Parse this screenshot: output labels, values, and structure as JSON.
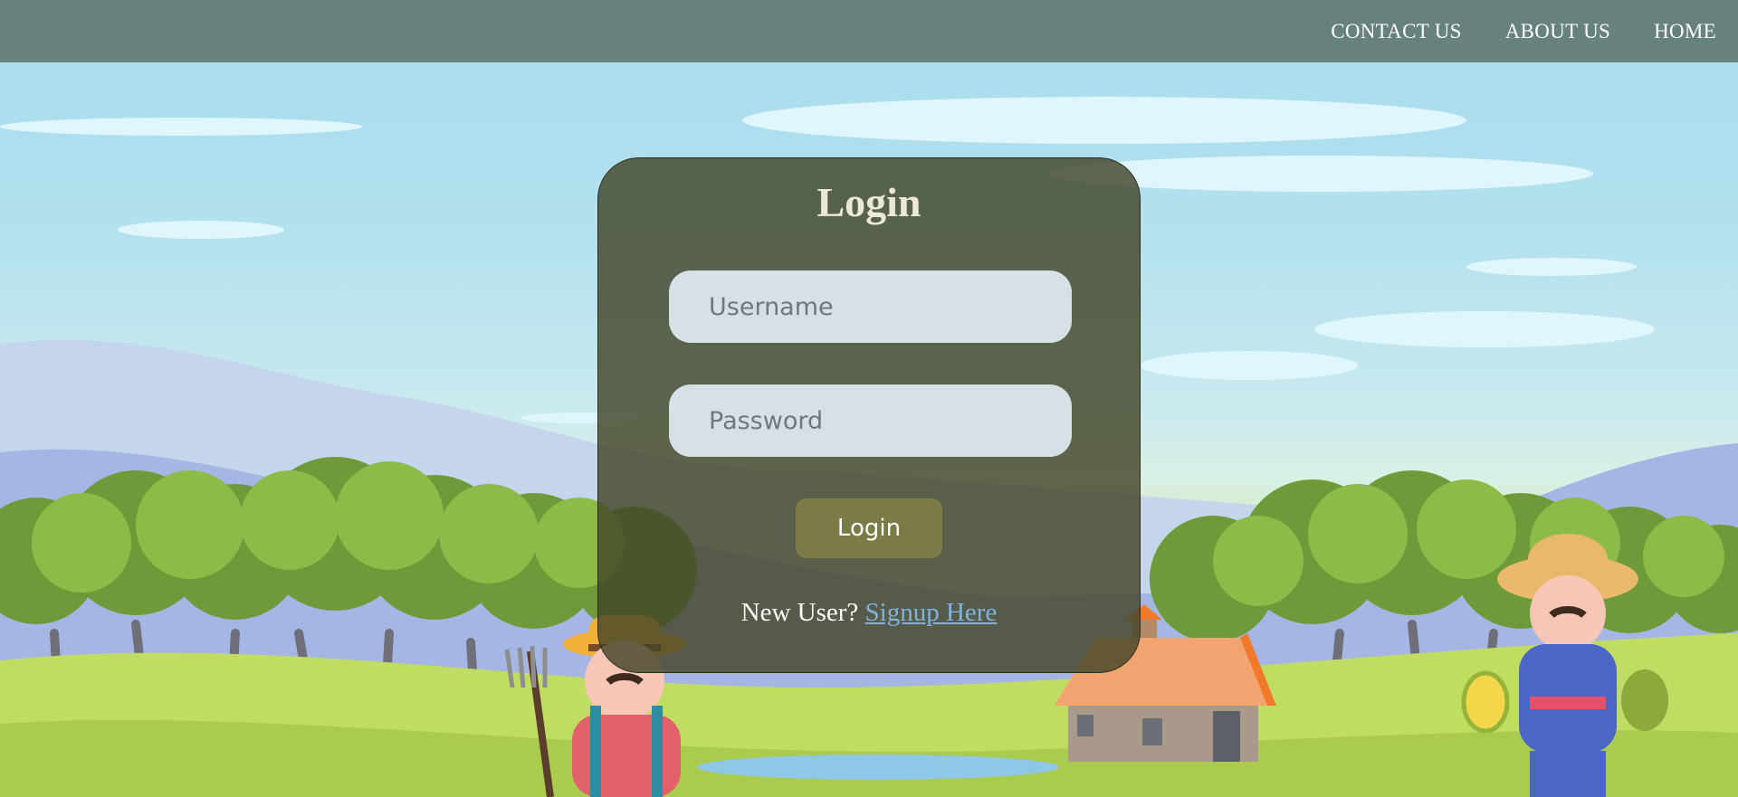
{
  "nav": {
    "contact": "CONTACT US",
    "about": "ABOUT US",
    "home": "HOME"
  },
  "login": {
    "title": "Login",
    "username_placeholder": "Username",
    "password_placeholder": "Password",
    "button_label": "Login",
    "new_user_text": "New User?",
    "signup_link": "Signup Here"
  },
  "colors": {
    "topbar": "#67817e",
    "card": "#434628",
    "button": "#7b7b47",
    "link": "#7fb3dc"
  }
}
